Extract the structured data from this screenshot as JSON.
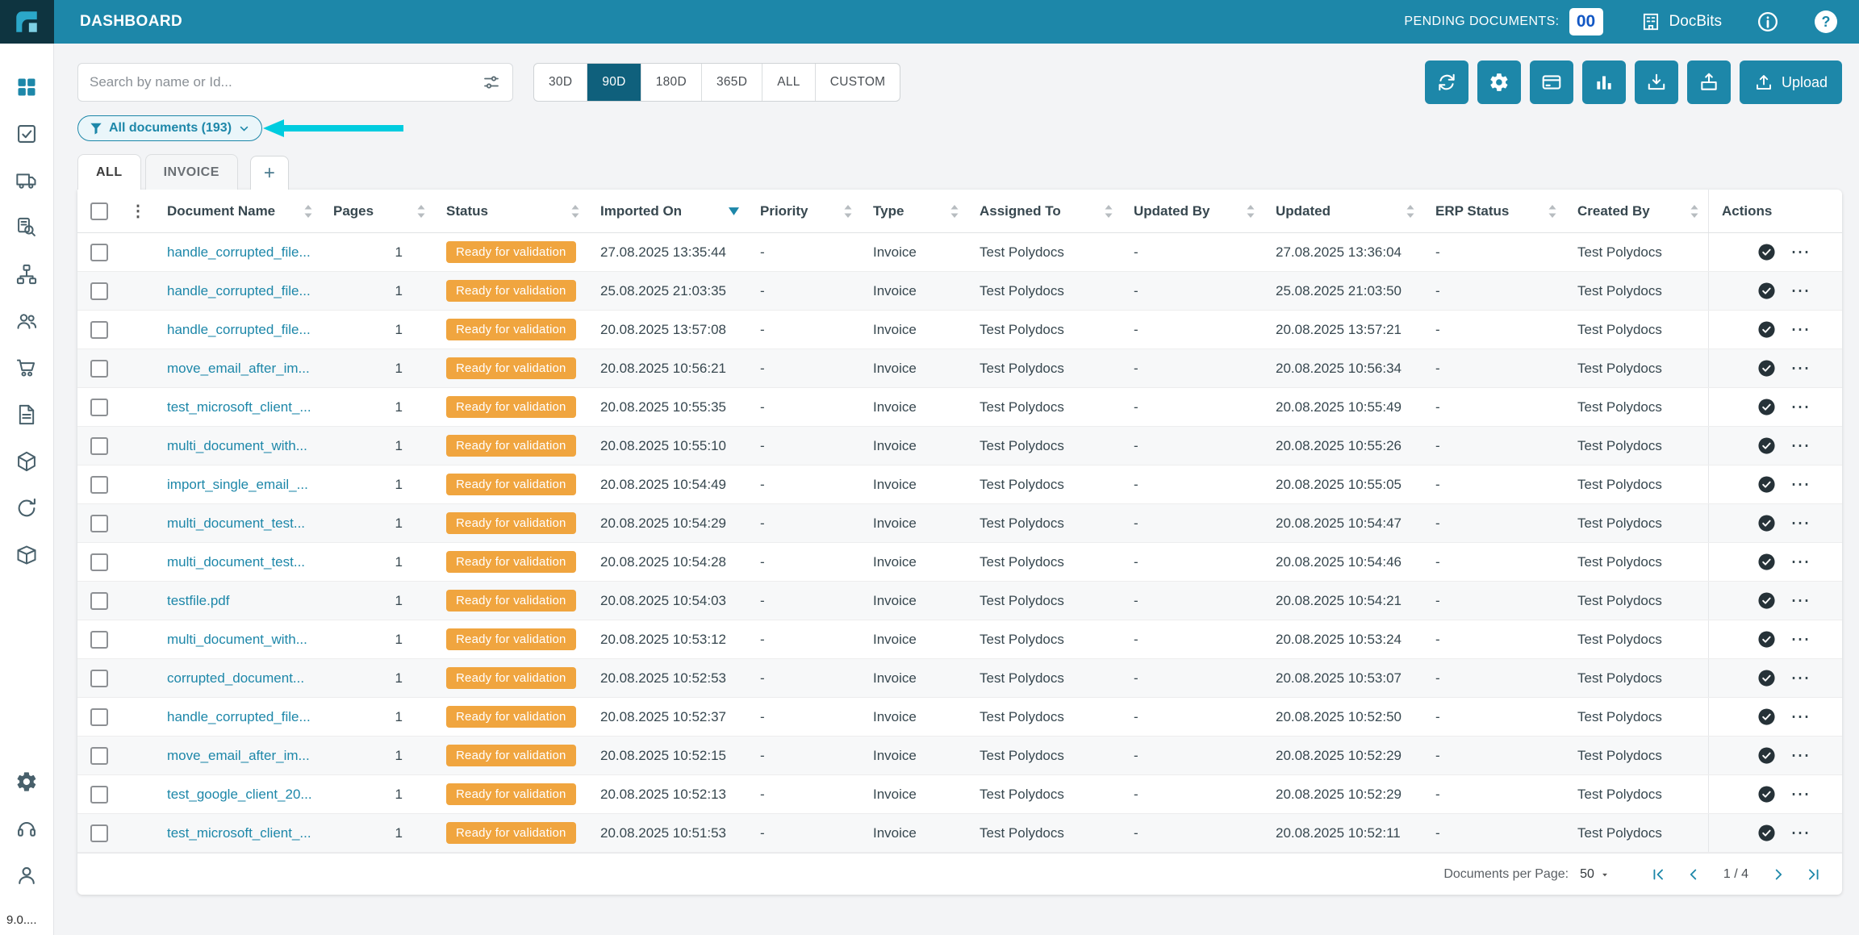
{
  "header": {
    "title": "DASHBOARD",
    "pending_label": "PENDING DOCUMENTS:",
    "pending_count": "00",
    "brand": "DocBits"
  },
  "sidebar": {
    "version": "9.0...."
  },
  "controls": {
    "search_placeholder": "Search by name or Id...",
    "ranges": [
      "30D",
      "90D",
      "180D",
      "365D",
      "ALL",
      "CUSTOM"
    ],
    "active_range": "90D",
    "upload_label": "Upload"
  },
  "filter": {
    "label": "All documents (193)"
  },
  "tabs": {
    "items": [
      "ALL",
      "INVOICE"
    ],
    "add_label": "+"
  },
  "table": {
    "columns": [
      "Document Name",
      "Pages",
      "Status",
      "Imported On",
      "Priority",
      "Type",
      "Assigned To",
      "Updated By",
      "Updated",
      "ERP Status",
      "Created By",
      "Actions"
    ],
    "sorted_column": "Imported On",
    "sort_direction": "desc",
    "rows": [
      {
        "name": "handle_corrupted_file...",
        "pages": "1",
        "status": "Ready for validation",
        "imported_on": "27.08.2025 13:35:44",
        "priority": "-",
        "type": "Invoice",
        "assigned_to": "Test Polydocs",
        "updated_by": "-",
        "updated": "27.08.2025 13:36:04",
        "erp_status": "-",
        "created_by": "Test Polydocs"
      },
      {
        "name": "handle_corrupted_file...",
        "pages": "1",
        "status": "Ready for validation",
        "imported_on": "25.08.2025 21:03:35",
        "priority": "-",
        "type": "Invoice",
        "assigned_to": "Test Polydocs",
        "updated_by": "-",
        "updated": "25.08.2025 21:03:50",
        "erp_status": "-",
        "created_by": "Test Polydocs"
      },
      {
        "name": "handle_corrupted_file...",
        "pages": "1",
        "status": "Ready for validation",
        "imported_on": "20.08.2025 13:57:08",
        "priority": "-",
        "type": "Invoice",
        "assigned_to": "Test Polydocs",
        "updated_by": "-",
        "updated": "20.08.2025 13:57:21",
        "erp_status": "-",
        "created_by": "Test Polydocs"
      },
      {
        "name": "move_email_after_im...",
        "pages": "1",
        "status": "Ready for validation",
        "imported_on": "20.08.2025 10:56:21",
        "priority": "-",
        "type": "Invoice",
        "assigned_to": "Test Polydocs",
        "updated_by": "-",
        "updated": "20.08.2025 10:56:34",
        "erp_status": "-",
        "created_by": "Test Polydocs"
      },
      {
        "name": "test_microsoft_client_...",
        "pages": "1",
        "status": "Ready for validation",
        "imported_on": "20.08.2025 10:55:35",
        "priority": "-",
        "type": "Invoice",
        "assigned_to": "Test Polydocs",
        "updated_by": "-",
        "updated": "20.08.2025 10:55:49",
        "erp_status": "-",
        "created_by": "Test Polydocs"
      },
      {
        "name": "multi_document_with...",
        "pages": "1",
        "status": "Ready for validation",
        "imported_on": "20.08.2025 10:55:10",
        "priority": "-",
        "type": "Invoice",
        "assigned_to": "Test Polydocs",
        "updated_by": "-",
        "updated": "20.08.2025 10:55:26",
        "erp_status": "-",
        "created_by": "Test Polydocs"
      },
      {
        "name": "import_single_email_...",
        "pages": "1",
        "status": "Ready for validation",
        "imported_on": "20.08.2025 10:54:49",
        "priority": "-",
        "type": "Invoice",
        "assigned_to": "Test Polydocs",
        "updated_by": "-",
        "updated": "20.08.2025 10:55:05",
        "erp_status": "-",
        "created_by": "Test Polydocs"
      },
      {
        "name": "multi_document_test...",
        "pages": "1",
        "status": "Ready for validation",
        "imported_on": "20.08.2025 10:54:29",
        "priority": "-",
        "type": "Invoice",
        "assigned_to": "Test Polydocs",
        "updated_by": "-",
        "updated": "20.08.2025 10:54:47",
        "erp_status": "-",
        "created_by": "Test Polydocs"
      },
      {
        "name": "multi_document_test...",
        "pages": "1",
        "status": "Ready for validation",
        "imported_on": "20.08.2025 10:54:28",
        "priority": "-",
        "type": "Invoice",
        "assigned_to": "Test Polydocs",
        "updated_by": "-",
        "updated": "20.08.2025 10:54:46",
        "erp_status": "-",
        "created_by": "Test Polydocs"
      },
      {
        "name": "testfile.pdf",
        "pages": "1",
        "status": "Ready for validation",
        "imported_on": "20.08.2025 10:54:03",
        "priority": "-",
        "type": "Invoice",
        "assigned_to": "Test Polydocs",
        "updated_by": "-",
        "updated": "20.08.2025 10:54:21",
        "erp_status": "-",
        "created_by": "Test Polydocs"
      },
      {
        "name": "multi_document_with...",
        "pages": "1",
        "status": "Ready for validation",
        "imported_on": "20.08.2025 10:53:12",
        "priority": "-",
        "type": "Invoice",
        "assigned_to": "Test Polydocs",
        "updated_by": "-",
        "updated": "20.08.2025 10:53:24",
        "erp_status": "-",
        "created_by": "Test Polydocs"
      },
      {
        "name": "corrupted_document...",
        "pages": "1",
        "status": "Ready for validation",
        "imported_on": "20.08.2025 10:52:53",
        "priority": "-",
        "type": "Invoice",
        "assigned_to": "Test Polydocs",
        "updated_by": "-",
        "updated": "20.08.2025 10:53:07",
        "erp_status": "-",
        "created_by": "Test Polydocs"
      },
      {
        "name": "handle_corrupted_file...",
        "pages": "1",
        "status": "Ready for validation",
        "imported_on": "20.08.2025 10:52:37",
        "priority": "-",
        "type": "Invoice",
        "assigned_to": "Test Polydocs",
        "updated_by": "-",
        "updated": "20.08.2025 10:52:50",
        "erp_status": "-",
        "created_by": "Test Polydocs"
      },
      {
        "name": "move_email_after_im...",
        "pages": "1",
        "status": "Ready for validation",
        "imported_on": "20.08.2025 10:52:15",
        "priority": "-",
        "type": "Invoice",
        "assigned_to": "Test Polydocs",
        "updated_by": "-",
        "updated": "20.08.2025 10:52:29",
        "erp_status": "-",
        "created_by": "Test Polydocs"
      },
      {
        "name": "test_google_client_20...",
        "pages": "1",
        "status": "Ready for validation",
        "imported_on": "20.08.2025 10:52:13",
        "priority": "-",
        "type": "Invoice",
        "assigned_to": "Test Polydocs",
        "updated_by": "-",
        "updated": "20.08.2025 10:52:29",
        "erp_status": "-",
        "created_by": "Test Polydocs"
      },
      {
        "name": "test_microsoft_client_...",
        "pages": "1",
        "status": "Ready for validation",
        "imported_on": "20.08.2025 10:51:53",
        "priority": "-",
        "type": "Invoice",
        "assigned_to": "Test Polydocs",
        "updated_by": "-",
        "updated": "20.08.2025 10:52:11",
        "erp_status": "-",
        "created_by": "Test Polydocs"
      }
    ]
  },
  "footer": {
    "per_page_label": "Documents per Page:",
    "per_page_value": "50",
    "page_indicator": "1 / 4"
  },
  "icons": {
    "sidebar": [
      "dashboard-grid",
      "tasks-check",
      "truck",
      "document-search",
      "workflow",
      "team",
      "cart",
      "invoice-doc",
      "package-cube",
      "refresh-cycle",
      "inventory-box",
      "settings-gear",
      "headset",
      "user"
    ],
    "topbar": [
      "building",
      "info-circle",
      "help-circle"
    ],
    "toolbar": [
      "sync",
      "gear",
      "card",
      "bar-chart",
      "import-tray",
      "export-box",
      "upload"
    ],
    "misc": [
      "filter-funnel",
      "chevron-down",
      "tune-sliders",
      "column-menu-dots",
      "sort-carets",
      "sorted-desc-arrow",
      "circle-check",
      "more-dots",
      "first-page",
      "prev-page",
      "next-page",
      "last-page"
    ]
  },
  "colors": {
    "accent": "#1d87a9",
    "active_segment": "#0f607c",
    "status_badge": "#f0a53f",
    "pending_count_text": "#1257c4",
    "highlight_arrow": "#00ccdf",
    "logo_background": "#0e3440"
  }
}
